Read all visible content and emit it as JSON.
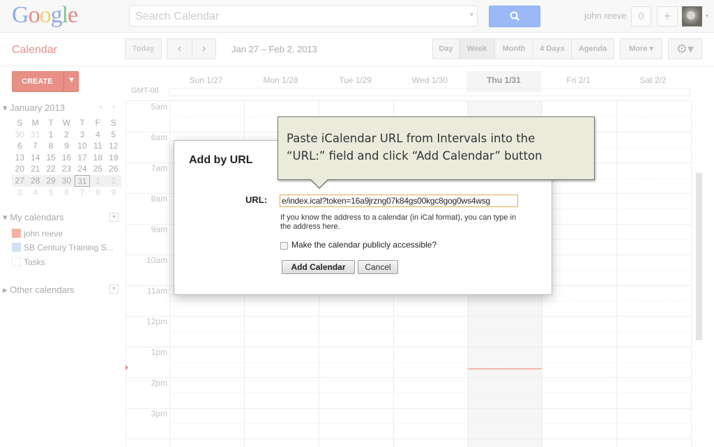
{
  "header": {
    "logo": [
      "G",
      "o",
      "o",
      "g",
      "l",
      "e"
    ],
    "search_placeholder": "Search Calendar",
    "search_icon": "search-icon",
    "user_name": "john reeve",
    "notification_count": "0",
    "share_label": "+",
    "avatar_caret": "▾"
  },
  "toolbar": {
    "app_title": "Calendar",
    "today_label": "Today",
    "prev_label": "‹",
    "next_label": "›",
    "date_range": "Jan 27 – Feb 2, 2013",
    "views": [
      "Day",
      "Week",
      "Month",
      "4 Days",
      "Agenda"
    ],
    "active_view": "Week",
    "more_label": "More ▾",
    "settings_label": "⚙▾"
  },
  "sidebar": {
    "create_label": "CREATE",
    "create_caret": "▼",
    "mini_calendar": {
      "title": "January 2013",
      "prev": "‹",
      "next": "›",
      "weekdays": [
        "S",
        "M",
        "T",
        "W",
        "T",
        "F",
        "S"
      ],
      "weeks": [
        [
          "30",
          "31",
          "1",
          "2",
          "3",
          "4",
          "5"
        ],
        [
          "6",
          "7",
          "8",
          "9",
          "10",
          "11",
          "12"
        ],
        [
          "13",
          "14",
          "15",
          "16",
          "17",
          "18",
          "19"
        ],
        [
          "20",
          "21",
          "22",
          "23",
          "24",
          "25",
          "26"
        ],
        [
          "27",
          "28",
          "29",
          "30",
          "31",
          "1",
          "2"
        ],
        [
          "3",
          "4",
          "5",
          "6",
          "7",
          "8",
          "9"
        ]
      ],
      "today": "31"
    },
    "my_calendars_title": "My calendars",
    "my_calendars": [
      {
        "name": "john reeve",
        "color": "#f4b3a2"
      },
      {
        "name": "SB Century Training S...",
        "color": "#d3e1f3"
      },
      {
        "name": "Tasks",
        "color": "#ffffff"
      }
    ],
    "other_calendars_title": "Other calendars",
    "dropdown_glyph": "▼",
    "expand_glyph": "▾",
    "collapse_glyph": "▸"
  },
  "week": {
    "timezone": "GMT-08",
    "days": [
      "Sun 1/27",
      "Mon 1/28",
      "Tue 1/29",
      "Wed 1/30",
      "Thu 1/31",
      "Fri 2/1",
      "Sat 2/2"
    ],
    "today_index": 4,
    "hours": [
      "5am",
      "6am",
      "7am",
      "8am",
      "9am",
      "10am",
      "11am",
      "12pm",
      "1pm",
      "2pm",
      "3pm"
    ]
  },
  "dialog": {
    "title": "Add by URL",
    "url_label": "URL:",
    "url_value": "e/index.ical?token=16a9jrzng07k84gs00kgc8gog0ws4wsg",
    "help_text": "If you know the address to a calendar (in iCal format), you can type in the address here.",
    "public_label": "Make the calendar publicly accessible?",
    "public_checked": false,
    "add_label": "Add Calendar",
    "cancel_label": "Cancel"
  },
  "callout": {
    "text_line1": "Paste iCalendar URL from Intervals into the",
    "text_line2": "“URL:” field and click “Add Calendar” button"
  }
}
